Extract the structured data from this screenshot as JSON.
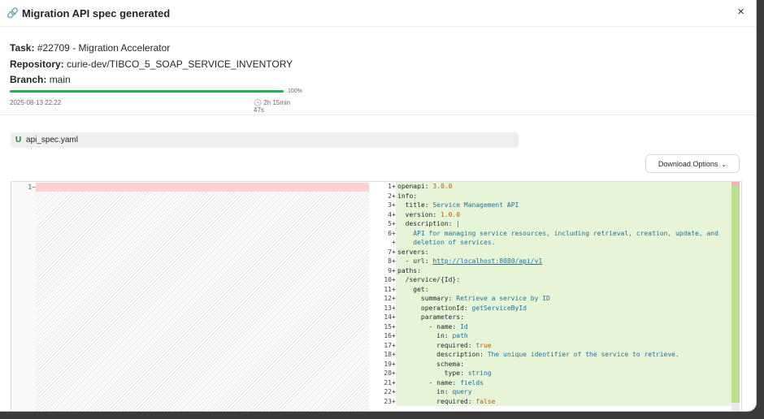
{
  "modal": {
    "title": "Migration API spec generated",
    "title_icon": "link-icon",
    "close_label": "×"
  },
  "task": {
    "task_label": "Task:",
    "task_value": "#22709 - Migration Accelerator",
    "repo_label": "Repository:",
    "repo_value": "curie-dev/TIBCO_5_SOAP_SERVICE_INVENTORY",
    "branch_label": "Branch:",
    "branch_value": "main"
  },
  "progress": {
    "percent_label": "100%",
    "percent_value": 100,
    "date": "2025-08-13 22:22",
    "duration": "2h 15min 47s",
    "fill_color": "#22b14c"
  },
  "file": {
    "status": "U",
    "name": "api_spec.yaml"
  },
  "download": {
    "label": "Download Options"
  },
  "diff": {
    "left_lines": [
      {
        "num": "1",
        "sign": "−"
      }
    ],
    "right_lines": [
      {
        "num": "1",
        "sign": "+",
        "code": [
          {
            "t": "k",
            "v": "openapi: "
          },
          {
            "t": "n",
            "v": "3.0.0"
          }
        ]
      },
      {
        "num": "2",
        "sign": "+",
        "code": [
          {
            "t": "k",
            "v": "info:"
          }
        ]
      },
      {
        "num": "3",
        "sign": "+",
        "code": [
          {
            "t": "k",
            "v": "  title: "
          },
          {
            "t": "s",
            "v": "Service Management API"
          }
        ]
      },
      {
        "num": "4",
        "sign": "+",
        "code": [
          {
            "t": "k",
            "v": "  version: "
          },
          {
            "t": "n",
            "v": "1.0.0"
          }
        ]
      },
      {
        "num": "5",
        "sign": "+",
        "code": [
          {
            "t": "k",
            "v": "  description: "
          },
          {
            "t": "s",
            "v": "|"
          }
        ]
      },
      {
        "num": "6",
        "sign": "+",
        "code": [
          {
            "t": "s",
            "v": "    API for managing service resources, including retrieval, creation, update, and"
          }
        ]
      },
      {
        "num": "",
        "sign": "+",
        "code": [
          {
            "t": "s",
            "v": "    deletion of services."
          }
        ]
      },
      {
        "num": "7",
        "sign": "+",
        "code": [
          {
            "t": "k",
            "v": "servers:"
          }
        ]
      },
      {
        "num": "8",
        "sign": "+",
        "code": [
          {
            "t": "k",
            "v": "  - url: "
          },
          {
            "t": "l",
            "v": "http://localhost:8080/api/v1"
          }
        ]
      },
      {
        "num": "9",
        "sign": "+",
        "code": [
          {
            "t": "k",
            "v": "paths:"
          }
        ]
      },
      {
        "num": "10",
        "sign": "+",
        "code": [
          {
            "t": "k",
            "v": "  /service/{Id}:"
          }
        ]
      },
      {
        "num": "11",
        "sign": "+",
        "code": [
          {
            "t": "k",
            "v": "    get:"
          }
        ]
      },
      {
        "num": "12",
        "sign": "+",
        "code": [
          {
            "t": "k",
            "v": "      summary: "
          },
          {
            "t": "s",
            "v": "Retrieve a service by ID"
          }
        ]
      },
      {
        "num": "13",
        "sign": "+",
        "code": [
          {
            "t": "k",
            "v": "      operationId: "
          },
          {
            "t": "s",
            "v": "getServiceById"
          }
        ]
      },
      {
        "num": "14",
        "sign": "+",
        "code": [
          {
            "t": "k",
            "v": "      parameters:"
          }
        ]
      },
      {
        "num": "15",
        "sign": "+",
        "code": [
          {
            "t": "k",
            "v": "        - name: "
          },
          {
            "t": "s",
            "v": "Id"
          }
        ]
      },
      {
        "num": "16",
        "sign": "+",
        "code": [
          {
            "t": "k",
            "v": "          in: "
          },
          {
            "t": "s",
            "v": "path"
          }
        ]
      },
      {
        "num": "17",
        "sign": "+",
        "code": [
          {
            "t": "k",
            "v": "          required: "
          },
          {
            "t": "n",
            "v": "true"
          }
        ]
      },
      {
        "num": "18",
        "sign": "+",
        "code": [
          {
            "t": "k",
            "v": "          description: "
          },
          {
            "t": "s",
            "v": "The unique identifier of the service to retrieve."
          }
        ]
      },
      {
        "num": "19",
        "sign": "+",
        "code": [
          {
            "t": "k",
            "v": "          schema:"
          }
        ]
      },
      {
        "num": "20",
        "sign": "+",
        "code": [
          {
            "t": "k",
            "v": "            type: "
          },
          {
            "t": "s",
            "v": "string"
          }
        ]
      },
      {
        "num": "21",
        "sign": "+",
        "code": [
          {
            "t": "k",
            "v": "        - name: "
          },
          {
            "t": "s",
            "v": "fields"
          }
        ]
      },
      {
        "num": "22",
        "sign": "+",
        "code": [
          {
            "t": "k",
            "v": "          in: "
          },
          {
            "t": "s",
            "v": "query"
          }
        ]
      },
      {
        "num": "23",
        "sign": "+",
        "code": [
          {
            "t": "k",
            "v": "          required: "
          },
          {
            "t": "n",
            "v": "false"
          }
        ]
      }
    ]
  },
  "colors": {
    "added_bg": "#e6f5d8",
    "removed_bg": "#ffd0d0",
    "string": "#22709b",
    "number": "#c35b00"
  }
}
